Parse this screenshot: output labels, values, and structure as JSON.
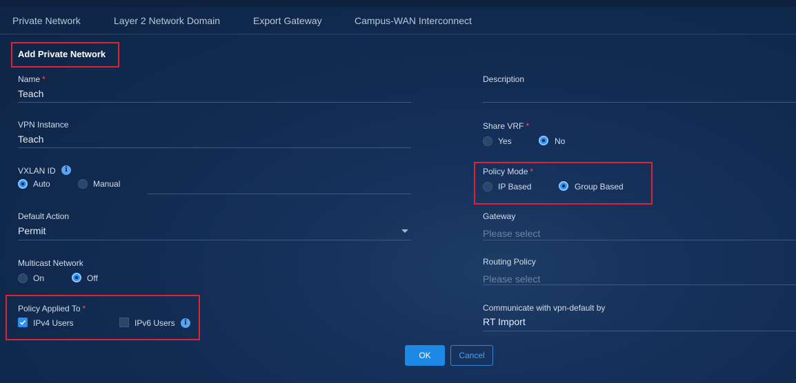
{
  "tabs": [
    "Private Network",
    "Layer 2 Network Domain",
    "Export Gateway",
    "Campus-WAN Interconnect"
  ],
  "form": {
    "title": "Add Private Network",
    "required_mark": "*",
    "name": {
      "label": "Name",
      "value": "Teach"
    },
    "description": {
      "label": "Description",
      "value": ""
    },
    "vpn_instance": {
      "label": "VPN Instance",
      "value": "Teach"
    },
    "share_vrf": {
      "label": "Share VRF",
      "options": [
        "Yes",
        "No"
      ],
      "selected": "No"
    },
    "vxlan_id": {
      "label": "VXLAN ID",
      "options": [
        "Auto",
        "Manual"
      ],
      "selected": "Auto",
      "info_icon": "info-icon"
    },
    "policy_mode": {
      "label": "Policy Mode",
      "options": [
        "IP Based",
        "Group Based"
      ],
      "selected": "Group Based"
    },
    "default_action": {
      "label": "Default Action",
      "value": "Permit"
    },
    "gateway": {
      "label": "Gateway",
      "placeholder": "Please select"
    },
    "multicast_network": {
      "label": "Multicast Network",
      "options": [
        "On",
        "Off"
      ],
      "selected": "Off"
    },
    "routing_policy": {
      "label": "Routing Policy",
      "placeholder": "Please select"
    },
    "policy_applied_to": {
      "label": "Policy Applied To",
      "options": [
        "IPv4 Users",
        "IPv6 Users"
      ],
      "checked": [
        "IPv4 Users"
      ]
    },
    "communicate": {
      "label": "Communicate with vpn-default by",
      "value": "RT Import"
    }
  },
  "buttons": {
    "ok": "OK",
    "cancel": "Cancel"
  },
  "colors": {
    "accent": "#1e88e5",
    "highlight": "#e0232f",
    "background": "#122b50"
  }
}
